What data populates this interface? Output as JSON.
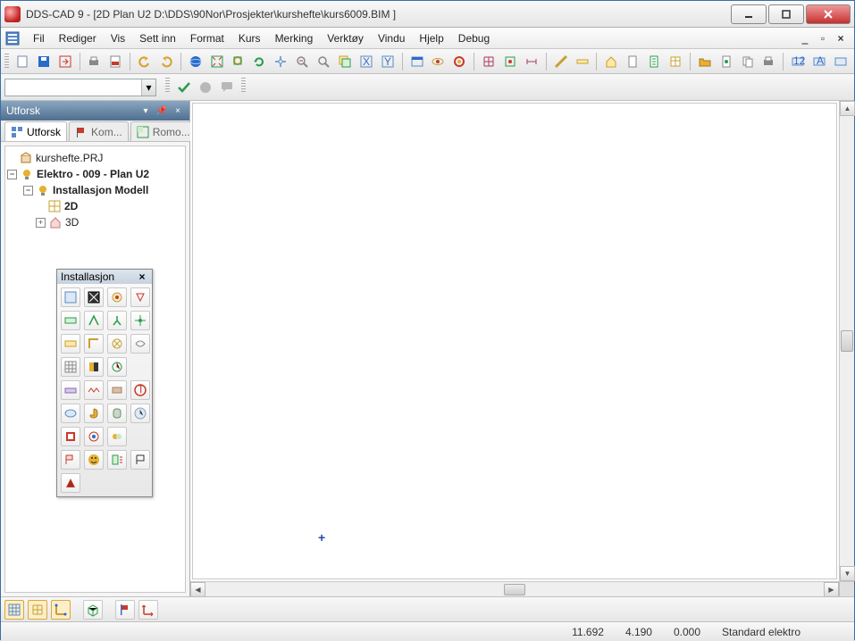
{
  "title": "DDS-CAD 9 - [2D  Plan U2  D:\\DDS\\90Nor\\Prosjekter\\kurshefte\\kurs6009.BIM ]",
  "menu": {
    "items": [
      "Fil",
      "Rediger",
      "Vis",
      "Sett inn",
      "Format",
      "Kurs",
      "Merking",
      "Verktøy",
      "Vindu",
      "Hjelp",
      "Debug"
    ]
  },
  "combo": {
    "value": ""
  },
  "utforsk": {
    "header": "Utforsk",
    "tabs": [
      {
        "label": "Utforsk",
        "active": true
      },
      {
        "label": "Kom...",
        "active": false
      },
      {
        "label": "Romo...",
        "active": false
      }
    ],
    "tree": {
      "prj": "kurshefte.PRJ",
      "elektro": "Elektro - 009 - Plan U2",
      "install": "Installasjon Modell",
      "d2": "2D",
      "d3": "3D"
    }
  },
  "palette": {
    "title": "Installasjon",
    "close": "×"
  },
  "status": {
    "x": "11.692",
    "y": "4.190",
    "z": "0.000",
    "mode": "Standard elektro"
  }
}
